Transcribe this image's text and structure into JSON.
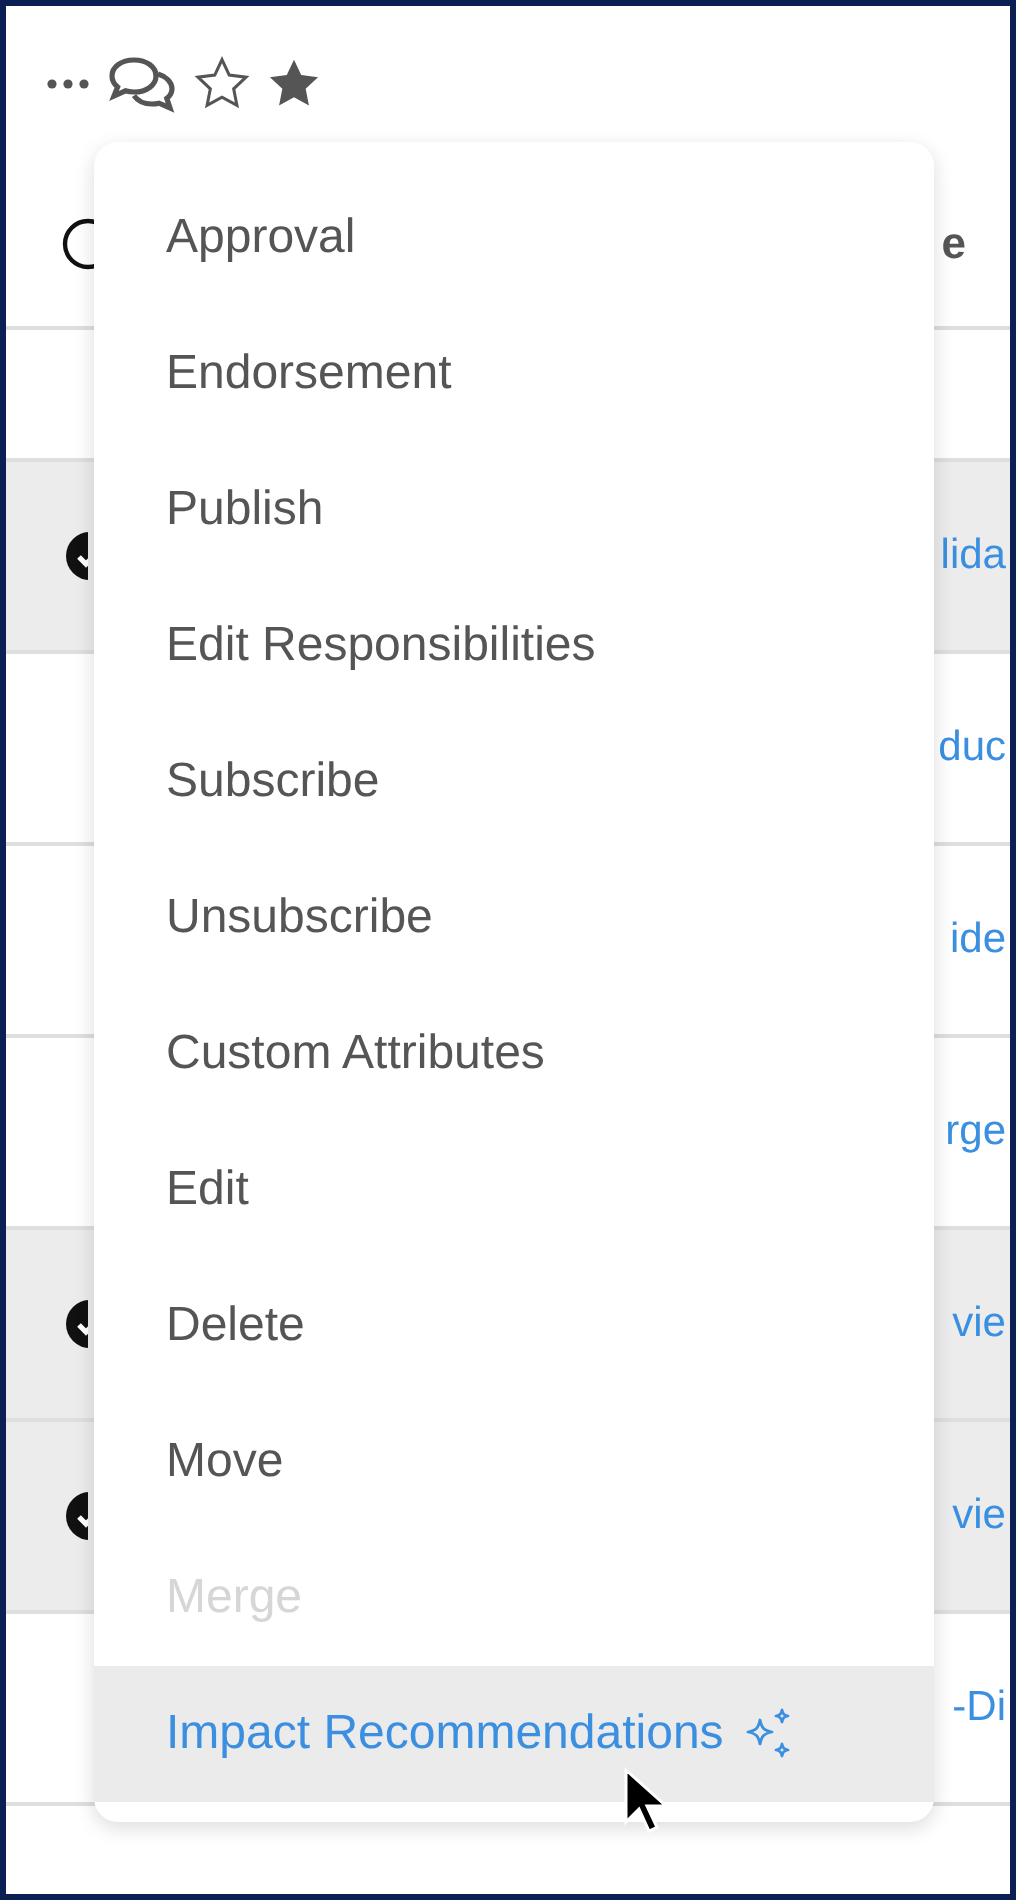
{
  "table": {
    "header": {
      "select_all_checked": false,
      "column_2": "e"
    },
    "rows": [
      {
        "selected": false,
        "checked": false
      },
      {
        "selected": true,
        "checked": true,
        "column_2": "lida"
      },
      {
        "selected": false,
        "checked": false,
        "column_2": "duc"
      },
      {
        "selected": false,
        "checked": false,
        "column_2": "ide"
      },
      {
        "selected": false,
        "checked": false,
        "column_2": "rge"
      },
      {
        "selected": true,
        "checked": true,
        "column_2": "vie"
      },
      {
        "selected": true,
        "checked": true,
        "column_2": "vie"
      },
      {
        "selected": false,
        "checked": false,
        "column_2": "-Di"
      }
    ]
  },
  "menu": {
    "items": [
      {
        "label": "Approval",
        "kind": "plain",
        "disabled": false,
        "selected": false
      },
      {
        "label": "Endorsement",
        "kind": "plain",
        "disabled": false,
        "selected": false
      },
      {
        "label": "Publish",
        "kind": "plain",
        "disabled": false,
        "selected": false
      },
      {
        "label": "Edit Responsibilities",
        "kind": "plain",
        "disabled": false,
        "selected": false
      },
      {
        "label": "Subscribe",
        "kind": "plain",
        "disabled": false,
        "selected": false
      },
      {
        "label": "Unsubscribe",
        "kind": "plain",
        "disabled": false,
        "selected": false
      },
      {
        "label": "Custom Attributes",
        "kind": "plain",
        "disabled": false,
        "selected": false
      },
      {
        "label": "Edit",
        "kind": "plain",
        "disabled": false,
        "selected": false
      },
      {
        "label": "Delete",
        "kind": "plain",
        "disabled": false,
        "selected": false
      },
      {
        "label": "Move",
        "kind": "plain",
        "disabled": false,
        "selected": false
      },
      {
        "label": "Merge",
        "kind": "plain",
        "disabled": true,
        "selected": false
      },
      {
        "label": "Impact Recommendations",
        "kind": "ai",
        "disabled": false,
        "selected": true
      }
    ]
  }
}
